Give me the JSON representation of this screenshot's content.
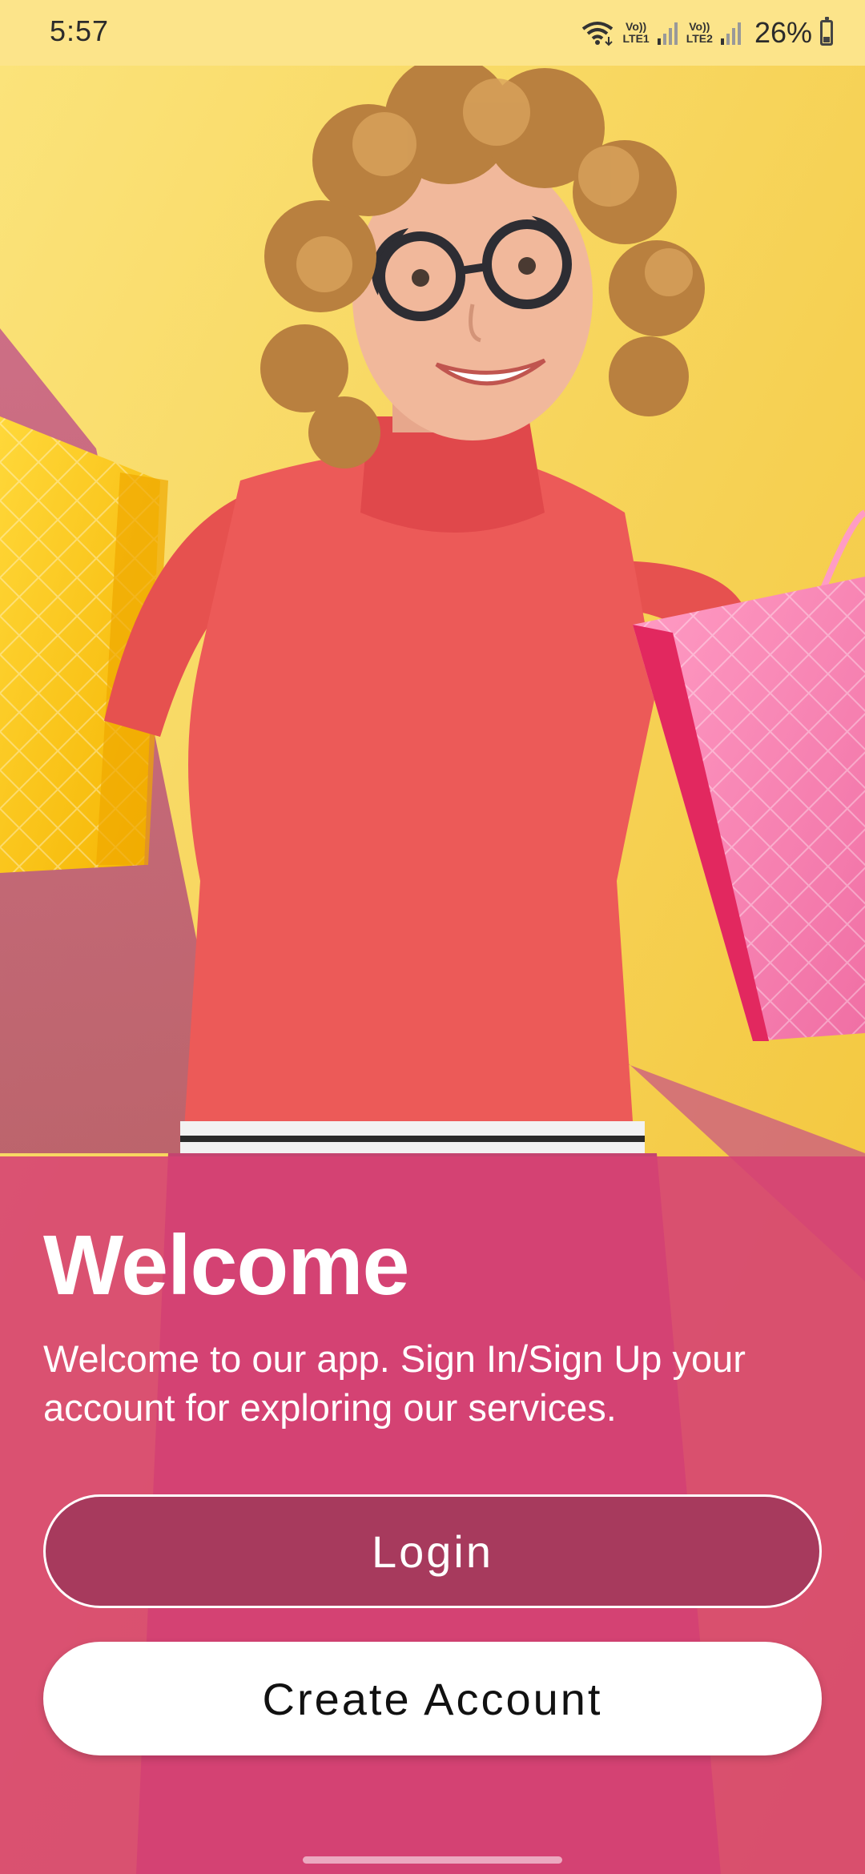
{
  "status_bar": {
    "time": "5:57",
    "sim1_label_top": "Vo))",
    "sim1_label_bottom": "LTE1",
    "sim2_label_top": "Vo))",
    "sim2_label_bottom": "LTE2",
    "battery_percent": "26%",
    "icons": [
      "wifi-icon",
      "signal-icon",
      "battery-icon"
    ]
  },
  "hero": {
    "icon": "hero-image"
  },
  "welcome": {
    "title": "Welcome",
    "description": "Welcome to our app. Sign In/Sign Up your account for exploring our services.",
    "panel_color": "#d64273"
  },
  "buttons": {
    "login_label": "Login",
    "create_account_label": "Create Account"
  }
}
